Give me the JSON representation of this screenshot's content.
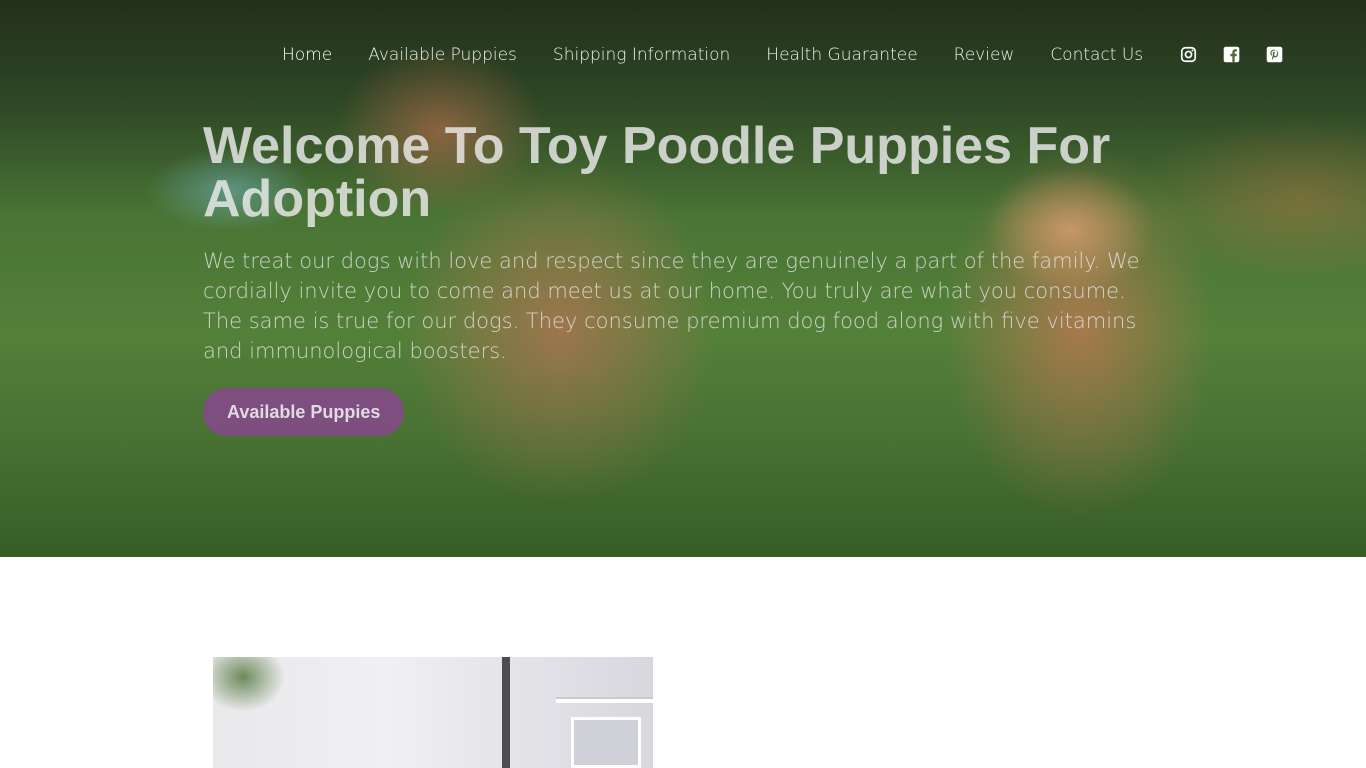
{
  "nav": {
    "items": [
      {
        "label": "Home",
        "active": true
      },
      {
        "label": "Available Puppies",
        "active": false
      },
      {
        "label": "Shipping Information",
        "active": false
      },
      {
        "label": "Health Guarantee",
        "active": false
      },
      {
        "label": "Review",
        "active": false
      },
      {
        "label": "Contact Us",
        "active": false
      }
    ],
    "social_icons": [
      "instagram-icon",
      "facebook-icon",
      "pinterest-icon"
    ]
  },
  "hero": {
    "title": "Welcome To Toy Poodle Puppies For Adoption",
    "text": "We treat our dogs with love and respect since they are genuinely a part of the family. We cordially invite you to come and meet us at our home. You truly are what you consume. The same is true for our dogs. They consume premium dog food along with five vitamins and immunological boosters.",
    "button_label": "Available Puppies"
  },
  "colors": {
    "button": "#86488c",
    "text_light": "#ebebeb"
  }
}
